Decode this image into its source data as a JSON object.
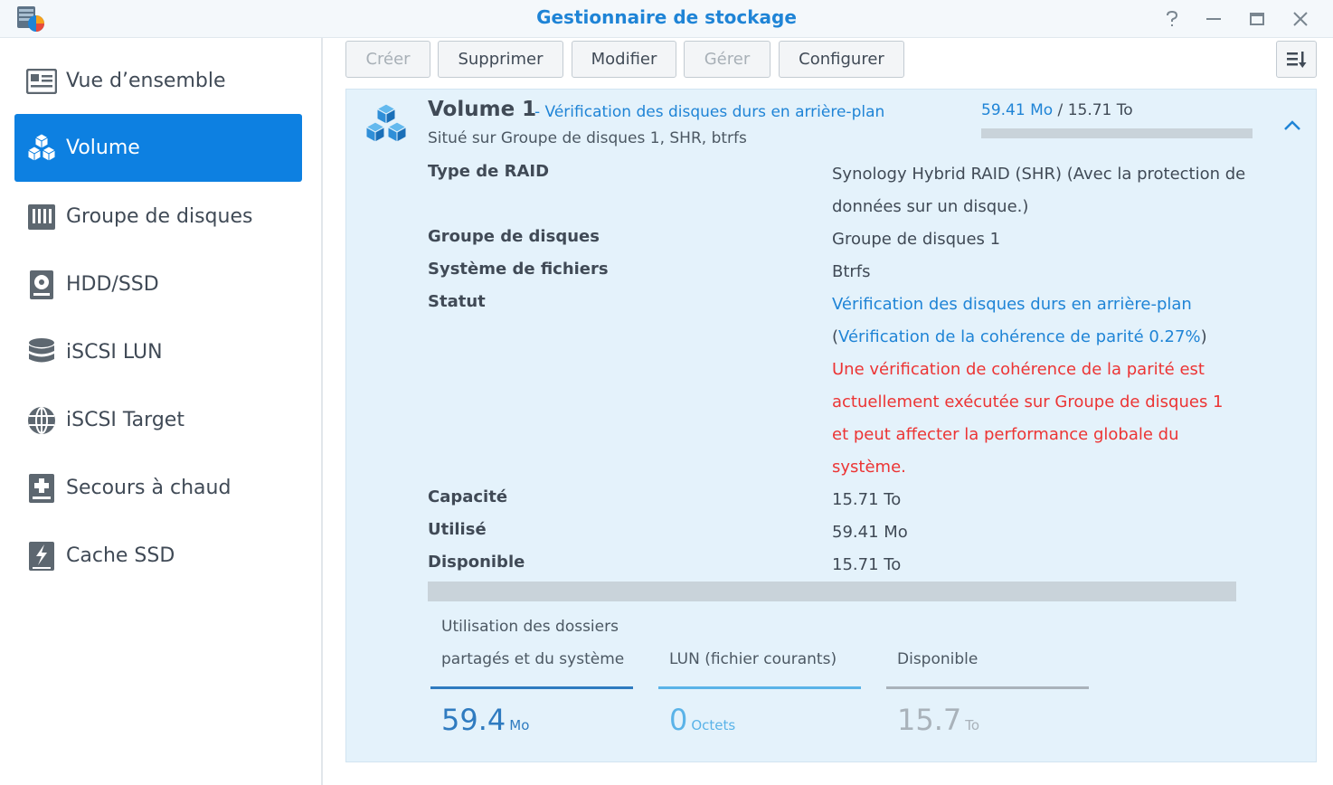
{
  "window": {
    "title": "Gestionnaire de stockage"
  },
  "sidebar": {
    "items": [
      {
        "label": "Vue d’ensemble",
        "icon": "overview-icon"
      },
      {
        "label": "Volume",
        "icon": "volume-cubes-icon"
      },
      {
        "label": "Groupe de disques",
        "icon": "disk-group-icon"
      },
      {
        "label": "HDD/SSD",
        "icon": "hdd-icon"
      },
      {
        "label": "iSCSI LUN",
        "icon": "database-icon"
      },
      {
        "label": "iSCSI Target",
        "icon": "globe-icon"
      },
      {
        "label": "Secours à chaud",
        "icon": "hot-spare-icon"
      },
      {
        "label": "Cache SSD",
        "icon": "ssd-cache-icon"
      }
    ],
    "active_index": 1
  },
  "toolbar": {
    "create_label": "Créer",
    "delete_label": "Supprimer",
    "edit_label": "Modifier",
    "manage_label": "Gérer",
    "configure_label": "Configurer"
  },
  "volume": {
    "name": "Volume 1",
    "status_short": "- Vérification des disques durs en arrière-plan",
    "location": "Situé sur Groupe de disques 1, SHR, btrfs",
    "used_display": "59.41 Mo",
    "usage_separator": " / ",
    "total_display": "15.71 To",
    "usage_fraction": 0.0,
    "details": {
      "raid_type_label": "Type de RAID",
      "raid_type_value": "Synology Hybrid RAID (SHR) (Avec la protection de données sur un disque.)",
      "disk_group_label": "Groupe de disques",
      "disk_group_value": "Groupe de disques 1",
      "filesystem_label": "Système de fichiers",
      "filesystem_value": "Btrfs",
      "status_label": "Statut",
      "status_value_main": "Vérification des disques durs en arrière-plan",
      "status_value_paren_open": "(",
      "status_value_progress": "Vérification de la cohérence de parité 0.27%",
      "status_value_paren_close": ")",
      "status_warning": "Une vérification de cohérence de la parité est actuellement exécutée sur Groupe de disques 1 et peut affecter la performance globale du système.",
      "capacity_label": "Capacité",
      "capacity_value": "15.71 To",
      "used_label": "Utilisé",
      "used_value": "59.41 Mo",
      "available_label": "Disponible",
      "available_value": "15.71 To"
    },
    "breakdown": [
      {
        "label": "Utilisation des dossiers partagés et du système",
        "value": "59.4",
        "unit": "Mo",
        "color": "#2f7bc0"
      },
      {
        "label": "LUN (fichier courants)",
        "value": "0",
        "unit": "Octets",
        "color": "#5ab3e8"
      },
      {
        "label": "Disponible",
        "value": "15.7",
        "unit": "To",
        "color": "#a9b2ba"
      }
    ]
  },
  "colors": {
    "accent": "#1f84d6",
    "active_nav": "#0d80e1",
    "warning": "#ec3434",
    "panel_bg": "#e4f2fb"
  }
}
